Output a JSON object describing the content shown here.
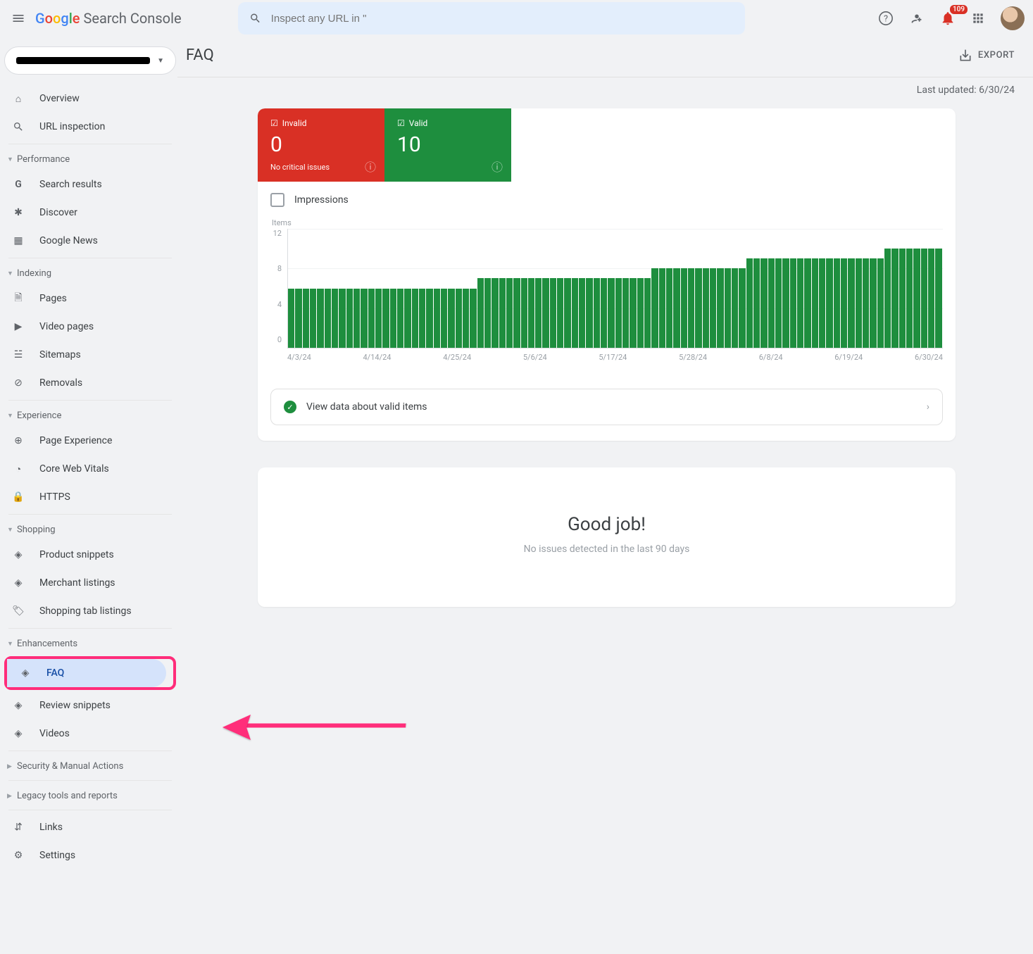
{
  "header": {
    "product_name": "Search Console",
    "search_placeholder": "Inspect any URL in \"",
    "notification_count": "109"
  },
  "sidebar": {
    "top": [
      {
        "icon": "home",
        "label": "Overview"
      },
      {
        "icon": "search",
        "label": "URL inspection"
      }
    ],
    "performance_heading": "Performance",
    "performance": [
      {
        "icon": "G",
        "label": "Search results"
      },
      {
        "icon": "star",
        "label": "Discover"
      },
      {
        "icon": "news",
        "label": "Google News"
      }
    ],
    "indexing_heading": "Indexing",
    "indexing": [
      {
        "icon": "page",
        "label": "Pages"
      },
      {
        "icon": "video",
        "label": "Video pages"
      },
      {
        "icon": "sitemap",
        "label": "Sitemaps"
      },
      {
        "icon": "hide",
        "label": "Removals"
      }
    ],
    "experience_heading": "Experience",
    "experience": [
      {
        "icon": "plus",
        "label": "Page Experience"
      },
      {
        "icon": "speed",
        "label": "Core Web Vitals"
      },
      {
        "icon": "lock",
        "label": "HTTPS"
      }
    ],
    "shopping_heading": "Shopping",
    "shopping": [
      {
        "icon": "layers",
        "label": "Product snippets"
      },
      {
        "icon": "layers",
        "label": "Merchant listings"
      },
      {
        "icon": "tag",
        "label": "Shopping tab listings"
      }
    ],
    "enhancements_heading": "Enhancements",
    "enhancements": [
      {
        "icon": "layers",
        "label": "FAQ"
      },
      {
        "icon": "layers",
        "label": "Review snippets"
      },
      {
        "icon": "layers",
        "label": "Videos"
      }
    ],
    "security_heading": "Security & Manual Actions",
    "legacy_heading": "Legacy tools and reports",
    "bottom": [
      {
        "icon": "links",
        "label": "Links"
      },
      {
        "icon": "gear",
        "label": "Settings"
      }
    ]
  },
  "page": {
    "title": "FAQ",
    "export_label": "EXPORT",
    "last_updated_label": "Last updated: ",
    "last_updated_date": "6/30/24",
    "tiles": {
      "invalid_label": "Invalid",
      "invalid_value": "0",
      "invalid_sub": "No critical issues",
      "valid_label": "Valid",
      "valid_value": "10"
    },
    "impressions_label": "Impressions",
    "view_valid_label": "View data about valid items",
    "goodjob_title": "Good job!",
    "goodjob_sub": "No issues detected in the last 90 days"
  },
  "chart_data": {
    "type": "bar",
    "title": "Items",
    "ylabel": "Items",
    "ylim": [
      0,
      12
    ],
    "yticks": [
      0,
      4,
      8,
      12
    ],
    "xticks": [
      "4/3/24",
      "4/14/24",
      "4/25/24",
      "5/6/24",
      "5/17/24",
      "5/28/24",
      "6/8/24",
      "6/19/24",
      "6/30/24"
    ],
    "categories_note": "approx 90 daily bars from 4/3/24 to 6/30/24",
    "values": [
      6,
      6,
      6,
      6,
      6,
      6,
      6,
      6,
      6,
      6,
      6,
      6,
      6,
      6,
      6,
      6,
      6,
      6,
      6,
      6,
      6,
      6,
      6,
      6,
      6,
      6,
      7,
      7,
      7,
      7,
      7,
      7,
      7,
      7,
      7,
      7,
      7,
      7,
      7,
      7,
      7,
      7,
      7,
      7,
      7,
      7,
      7,
      7,
      7,
      7,
      8,
      8,
      8,
      8,
      8,
      8,
      8,
      8,
      8,
      8,
      8,
      8,
      8,
      9,
      9,
      9,
      9,
      9,
      9,
      9,
      9,
      9,
      9,
      9,
      9,
      9,
      9,
      9,
      9,
      9,
      9,
      9,
      10,
      10,
      10,
      10,
      10,
      10,
      10,
      10
    ]
  }
}
